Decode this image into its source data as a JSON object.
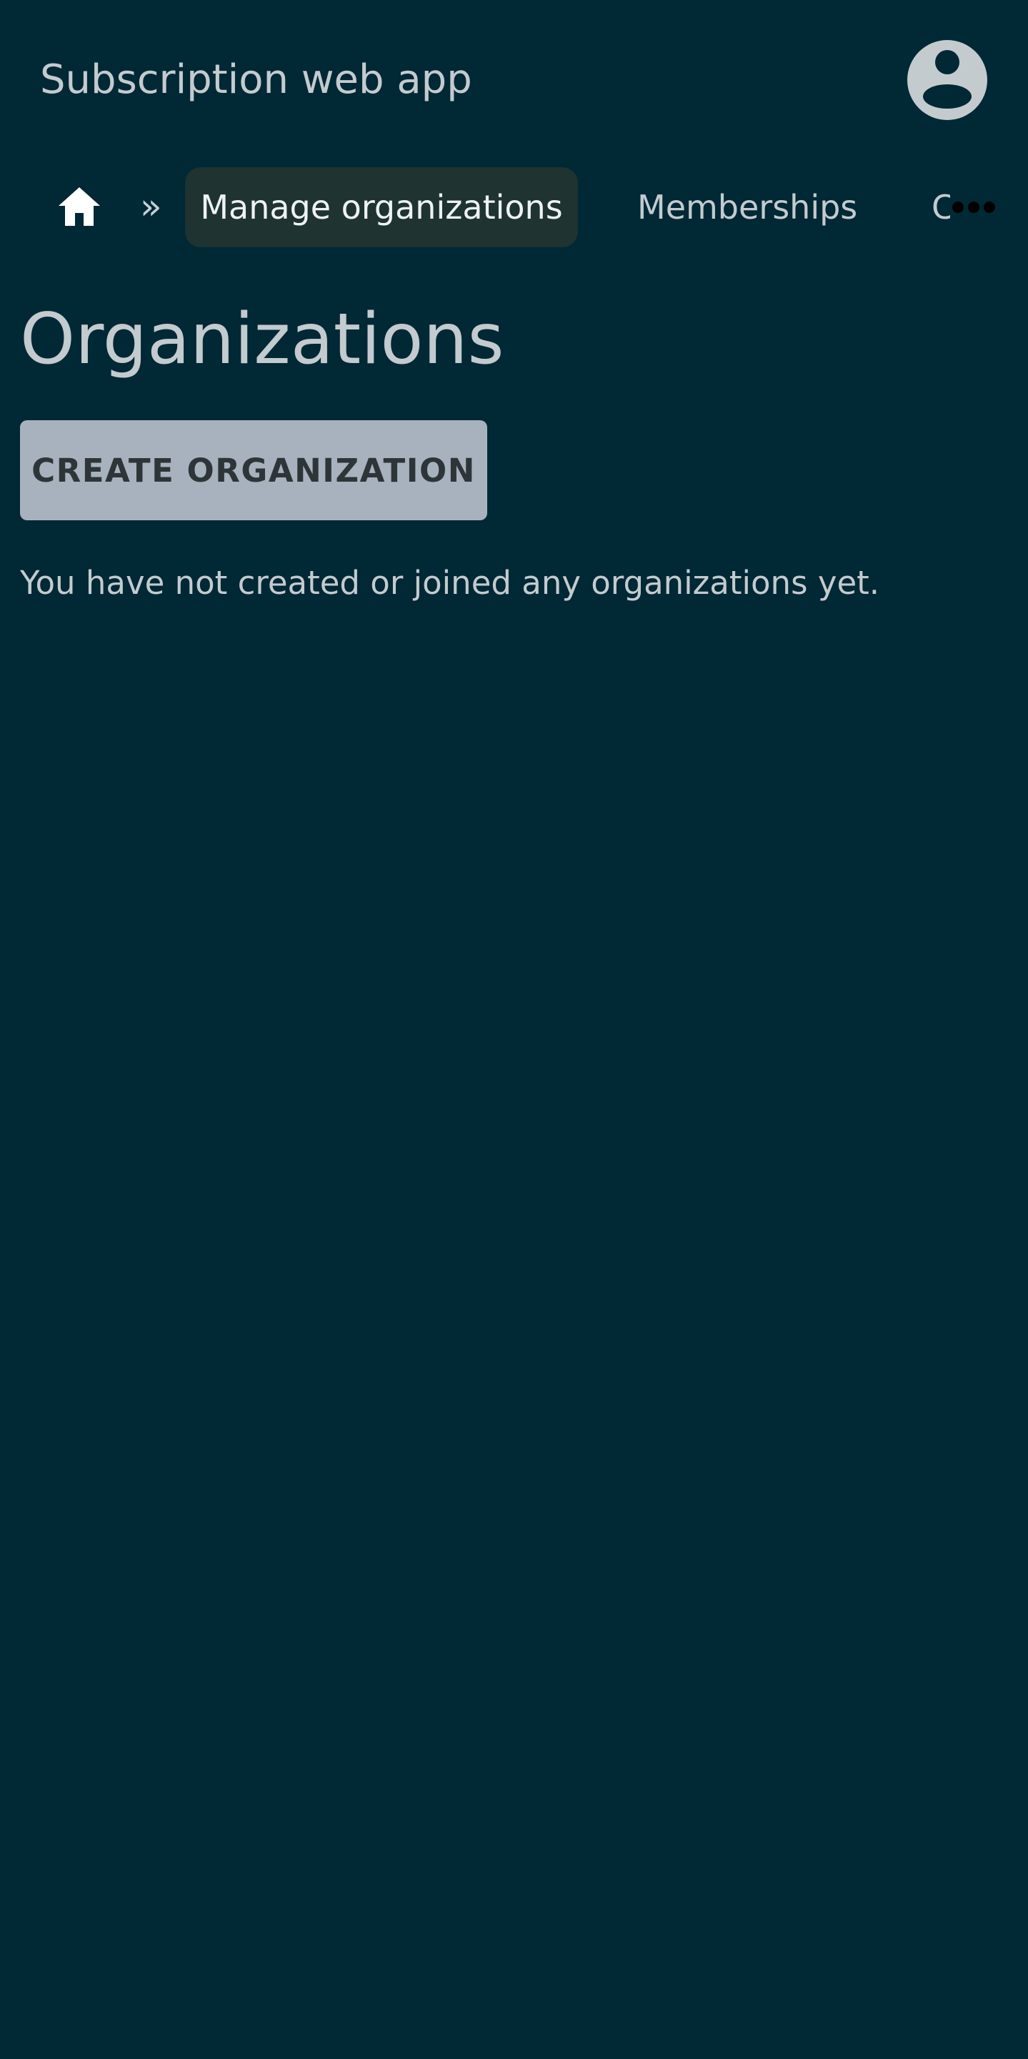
{
  "app": {
    "title": "Subscription web app"
  },
  "header": {
    "account_icon": "account-circle-icon"
  },
  "nav": {
    "home_icon": "home-icon",
    "separator": "»",
    "tabs": [
      {
        "label": "Manage organizations",
        "active": true
      },
      {
        "label": "Memberships",
        "active": false
      },
      {
        "label": "C",
        "active": false
      }
    ],
    "overflow_icon": "more-horizontal-icon"
  },
  "main": {
    "title": "Organizations",
    "create_button_label": "CREATE ORGANIZATION",
    "empty_message": "You have not created or joined any organizations yet."
  },
  "colors": {
    "background": "#012835",
    "text": "#c3cbcf",
    "active_tab_bg": "#1f3330",
    "button_bg": "#a8b2be",
    "button_text": "#2e3538"
  }
}
